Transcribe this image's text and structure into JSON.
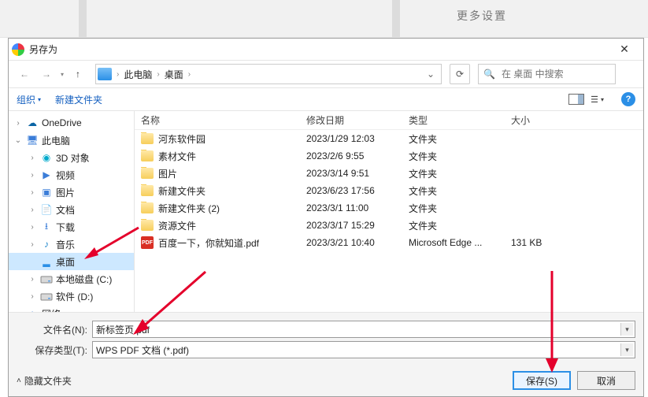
{
  "bg_hint_text": "更多设置",
  "dialog": {
    "title": "另存为"
  },
  "breadcrumb": {
    "root": "此电脑",
    "items": [
      "桌面"
    ]
  },
  "search": {
    "placeholder": "在 桌面 中搜索"
  },
  "toolbar": {
    "org": "组织",
    "newfolder": "新建文件夹"
  },
  "tree": [
    {
      "expander": ">",
      "icon": "onedrive",
      "label": "OneDrive",
      "indent": 0
    },
    {
      "expander": "v",
      "icon": "pc",
      "label": "此电脑",
      "indent": 0
    },
    {
      "expander": ">",
      "icon": "threed",
      "label": "3D 对象",
      "indent": 1
    },
    {
      "expander": ">",
      "icon": "video",
      "label": "视频",
      "indent": 1
    },
    {
      "expander": ">",
      "icon": "pic",
      "label": "图片",
      "indent": 1
    },
    {
      "expander": ">",
      "icon": "doc",
      "label": "文档",
      "indent": 1
    },
    {
      "expander": ">",
      "icon": "dl",
      "label": "下载",
      "indent": 1
    },
    {
      "expander": ">",
      "icon": "music",
      "label": "音乐",
      "indent": 1
    },
    {
      "expander": "",
      "icon": "desktop",
      "label": "桌面",
      "indent": 1,
      "selected": true
    },
    {
      "expander": ">",
      "icon": "disk",
      "label": "本地磁盘 (C:)",
      "indent": 1
    },
    {
      "expander": ">",
      "icon": "disk",
      "label": "软件 (D:)",
      "indent": 1
    },
    {
      "expander": ">",
      "icon": "net",
      "label": "网络",
      "indent": 0
    }
  ],
  "columns": {
    "name": "名称",
    "date": "修改日期",
    "type": "类型",
    "size": "大小"
  },
  "files": [
    {
      "icon": "folder",
      "name": "河东软件园",
      "date": "2023/1/29 12:03",
      "type": "文件夹",
      "size": ""
    },
    {
      "icon": "folder",
      "name": "素材文件",
      "date": "2023/2/6 9:55",
      "type": "文件夹",
      "size": ""
    },
    {
      "icon": "folder",
      "name": "图片",
      "date": "2023/3/14 9:51",
      "type": "文件夹",
      "size": ""
    },
    {
      "icon": "folder",
      "name": "新建文件夹",
      "date": "2023/6/23 17:56",
      "type": "文件夹",
      "size": ""
    },
    {
      "icon": "folder",
      "name": "新建文件夹 (2)",
      "date": "2023/3/1 11:00",
      "type": "文件夹",
      "size": ""
    },
    {
      "icon": "folder",
      "name": "资源文件",
      "date": "2023/3/17 15:29",
      "type": "文件夹",
      "size": ""
    },
    {
      "icon": "pdf",
      "name": "百度一下，你就知道.pdf",
      "date": "2023/3/21 10:40",
      "type": "Microsoft Edge ...",
      "size": "131 KB"
    }
  ],
  "fields": {
    "filename_label": "文件名(N):",
    "filename_value": "新标签页.pdf",
    "filetype_label": "保存类型(T):",
    "filetype_value": "WPS PDF 文档 (*.pdf)"
  },
  "footer": {
    "hide": "隐藏文件夹",
    "save": "保存(S)",
    "cancel": "取消"
  },
  "icons": {
    "pdf": "PDF"
  }
}
